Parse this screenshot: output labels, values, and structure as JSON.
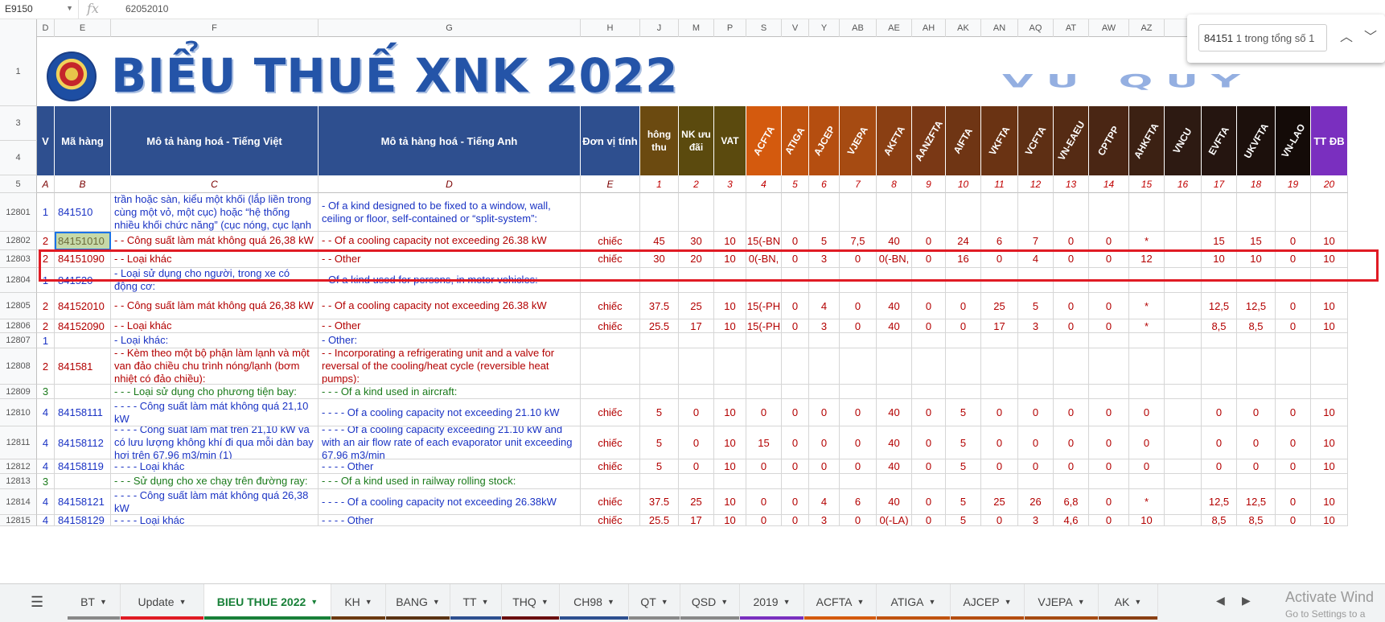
{
  "formula": {
    "cell_ref": "E9150",
    "fx_label": "fx",
    "value": "62052010"
  },
  "find": {
    "query": "84151",
    "count_text": " 1 trong tổng số 1"
  },
  "columns_header": [
    "D",
    "E",
    "F",
    "G",
    "H",
    "J",
    "M",
    "P",
    "S",
    "V",
    "Y",
    "AB",
    "AE",
    "AH",
    "AK",
    "AN",
    "AQ",
    "AT",
    "AW",
    "AZ"
  ],
  "rows_top": [
    "1",
    "3",
    "4",
    "5"
  ],
  "banner": {
    "title": "BIỂU THUẾ XNK 2022",
    "watermark": "VU QUY"
  },
  "headers": {
    "v": "V",
    "ma_hang": "Mã hàng",
    "mo_ta_vi": "Mô tả hàng hoá - Tiếng Việt",
    "mo_ta_en": "Mô tả hàng hoá - Tiếng Anh",
    "don_vi": "Đơn vị tính",
    "thong_thuong": "hông thu",
    "nk_uu_dai": "NK ưu đãi",
    "vat": "VAT",
    "acfta": "ACFTA",
    "atiga": "ATIGA",
    "ajcep": "AJCEP",
    "vjepa": "VJEPA",
    "akfta": "AKFTA",
    "aanzfta": "AANZFTA",
    "aifta": "AIFTA",
    "vkfta": "VKFTA",
    "vcfta": "VCFTA",
    "vneaeu": "VN-EAEU",
    "cptpp": "CPTPP",
    "ahkfta": "AHKFTA",
    "vncu": "VNCU",
    "evfta": "EVFTA",
    "ukvfta": "UKVFTA",
    "vnlao": "VN-LAO",
    "ttdb": "TT ĐB"
  },
  "letters": [
    "A",
    "B",
    "C",
    "D",
    "E",
    "1",
    "2",
    "3",
    "4",
    "5",
    "6",
    "7",
    "8",
    "9",
    "10",
    "11",
    "12",
    "13",
    "14",
    "15",
    "16",
    "17",
    "18",
    "19",
    "20"
  ],
  "rows": [
    {
      "num": "12801",
      "v": "1",
      "code": "841510",
      "vi": "- Loại thiết kế để lắp vào cửa sổ, tường, trần hoặc sàn, kiểu một khối (lắp liền trong cùng một vỏ, một cục) hoặc “hệ thống nhiều khối chức năng” (cục nóng, cục lạnh tách biệt):",
      "en": "- Of a kind designed to be fixed to a window, wall, ceiling or floor, self-contained or “split-system”:",
      "unit": "",
      "vals": [
        "",
        "",
        "",
        "",
        "",
        "",
        "",
        "",
        "",
        "",
        "",
        "",
        "",
        "",
        "",
        "",
        "",
        "",
        "",
        "",
        "",
        ""
      ]
    },
    {
      "num": "12802",
      "v": "2",
      "code": "84151010",
      "vi": "- - Công suất làm mát không quá 26,38 kW",
      "en": "- - Of a cooling capacity not exceeding 26.38 kW",
      "unit": "chiếc",
      "vals": [
        "45",
        "30",
        "10",
        "15(-BN",
        "0",
        "5",
        "7,5",
        "40",
        "0",
        "24",
        "6",
        "7",
        "0",
        "0",
        "*",
        "",
        "15",
        "15",
        "0",
        "10"
      ]
    },
    {
      "num": "12803",
      "v": "2",
      "code": "84151090",
      "vi": "- - Loại khác",
      "en": "- - Other",
      "unit": "chiếc",
      "vals": [
        "30",
        "20",
        "10",
        "0(-BN,",
        "0",
        "3",
        "0",
        "0(-BN,",
        "0",
        "16",
        "0",
        "4",
        "0",
        "0",
        "12",
        "",
        "10",
        "10",
        "0",
        "10"
      ]
    },
    {
      "num": "12804",
      "v": "1",
      "code": "841520",
      "vi": "- Loại sử dụng cho người, trong xe có động cơ:",
      "en": "- Of a kind used for persons, in motor vehicles:",
      "unit": "",
      "vals": [
        "",
        "",
        "",
        "",
        "",
        "",
        "",
        "",
        "",
        "",
        "",
        "",
        "",
        "",
        "",
        "",
        "",
        "",
        "",
        ""
      ]
    },
    {
      "num": "12805",
      "v": "2",
      "code": "84152010",
      "vi": "- - Công suất làm mát không quá 26,38 kW",
      "en": "- - Of a cooling capacity not exceeding 26.38 kW",
      "unit": "chiếc",
      "vals": [
        "37.5",
        "25",
        "10",
        "15(-PH",
        "0",
        "4",
        "0",
        "40",
        "0",
        "0",
        "25",
        "5",
        "0",
        "0",
        "*",
        "",
        "12,5",
        "12,5",
        "0",
        "10"
      ]
    },
    {
      "num": "12806",
      "v": "2",
      "code": "84152090",
      "vi": "- - Loại khác",
      "en": "- - Other",
      "unit": "chiếc",
      "vals": [
        "25.5",
        "17",
        "10",
        "15(-PH",
        "0",
        "3",
        "0",
        "40",
        "0",
        "0",
        "17",
        "3",
        "0",
        "0",
        "*",
        "",
        "8,5",
        "8,5",
        "0",
        "10"
      ]
    },
    {
      "num": "12807",
      "v": "1",
      "code": "",
      "vi": "- Loại khác:",
      "en": "- Other:",
      "unit": "",
      "vals": [
        "",
        "",
        "",
        "",
        "",
        "",
        "",
        "",
        "",
        "",
        "",
        "",
        "",
        "",
        "",
        "",
        "",
        "",
        "",
        ""
      ]
    },
    {
      "num": "12808",
      "v": "2",
      "code": "841581",
      "vi": "- - Kèm theo một bộ phận làm lạnh và một van đảo chiều chu trình nóng/lạnh (bơm nhiệt có đảo chiều):",
      "en": "- - Incorporating a refrigerating unit and a valve for reversal of the cooling/heat cycle (reversible heat pumps):",
      "unit": "",
      "vals": [
        "",
        "",
        "",
        "",
        "",
        "",
        "",
        "",
        "",
        "",
        "",
        "",
        "",
        "",
        "",
        "",
        "",
        "",
        "",
        ""
      ]
    },
    {
      "num": "12809",
      "v": "3",
      "code": "",
      "vi": "- - - Loại sử dụng cho phương tiện bay:",
      "en": "- - - Of a kind used in aircraft:",
      "unit": "",
      "vals": [
        "",
        "",
        "",
        "",
        "",
        "",
        "",
        "",
        "",
        "",
        "",
        "",
        "",
        "",
        "",
        "",
        "",
        "",
        "",
        ""
      ]
    },
    {
      "num": "12810",
      "v": "4",
      "code": "84158111",
      "vi": "- - - - Công suất làm mát không quá 21,10 kW",
      "en": "- - - - Of a cooling capacity not exceeding 21.10 kW",
      "unit": "chiếc",
      "vals": [
        "5",
        "0",
        "10",
        "0",
        "0",
        "0",
        "0",
        "40",
        "0",
        "5",
        "0",
        "0",
        "0",
        "0",
        "0",
        "",
        "0",
        "0",
        "0",
        "10"
      ]
    },
    {
      "num": "12811",
      "v": "4",
      "code": "84158112",
      "vi": "- - - - Công suất làm mát trên 21,10 kW và có lưu lượng không khí đi qua mỗi dàn bay hơi trên 67,96 m3/min (1)",
      "en": "- - - - Of a cooling capacity exceeding 21.10 kW and with an air flow rate of each evaporator unit exceeding 67.96 m3/min",
      "unit": "chiếc",
      "vals": [
        "5",
        "0",
        "10",
        "15",
        "0",
        "0",
        "0",
        "40",
        "0",
        "5",
        "0",
        "0",
        "0",
        "0",
        "0",
        "",
        "0",
        "0",
        "0",
        "10"
      ]
    },
    {
      "num": "12812",
      "v": "4",
      "code": "84158119",
      "vi": "- - - - Loại khác",
      "en": "- - - - Other",
      "unit": "chiếc",
      "vals": [
        "5",
        "0",
        "10",
        "0",
        "0",
        "0",
        "0",
        "40",
        "0",
        "5",
        "0",
        "0",
        "0",
        "0",
        "0",
        "",
        "0",
        "0",
        "0",
        "10"
      ]
    },
    {
      "num": "12813",
      "v": "3",
      "code": "",
      "vi": "- - - Sử dụng cho xe chạy trên đường ray:",
      "en": "- - - Of a kind used in railway rolling stock:",
      "unit": "",
      "vals": [
        "",
        "",
        "",
        "",
        "",
        "",
        "",
        "",
        "",
        "",
        "",
        "",
        "",
        "",
        "",
        "",
        "",
        "",
        "",
        ""
      ]
    },
    {
      "num": "12814",
      "v": "4",
      "code": "84158121",
      "vi": "- - - - Công suất làm mát không quá 26,38 kW",
      "en": "- - - - Of a cooling capacity not exceeding 26.38kW",
      "unit": "chiếc",
      "vals": [
        "37.5",
        "25",
        "10",
        "0",
        "0",
        "4",
        "6",
        "40",
        "0",
        "5",
        "25",
        "26",
        "6,8",
        "0",
        "*",
        "",
        "12,5",
        "12,5",
        "0",
        "10"
      ]
    },
    {
      "num": "12815",
      "v": "4",
      "code": "84158129",
      "vi": "- - - - Loại khác",
      "en": "- - - - Other",
      "unit": "chiếc",
      "vals": [
        "25.5",
        "17",
        "10",
        "0",
        "0",
        "3",
        "0",
        "0(-LA)",
        "0",
        "5",
        "0",
        "3",
        "4,6",
        "0",
        "10",
        "",
        "8,5",
        "8,5",
        "0",
        "10"
      ]
    }
  ],
  "tabs": [
    "BT",
    "Update",
    "BIEU THUE 2022",
    "KH",
    "BANG",
    "TT",
    "THQ",
    "CH98",
    "QT",
    "QSD",
    "2019",
    "ACFTA",
    "ATIGA",
    "AJCEP",
    "VJEPA",
    "AK"
  ],
  "windows": {
    "line1": "Activate Wind",
    "line2": "Go to Settings to a"
  }
}
